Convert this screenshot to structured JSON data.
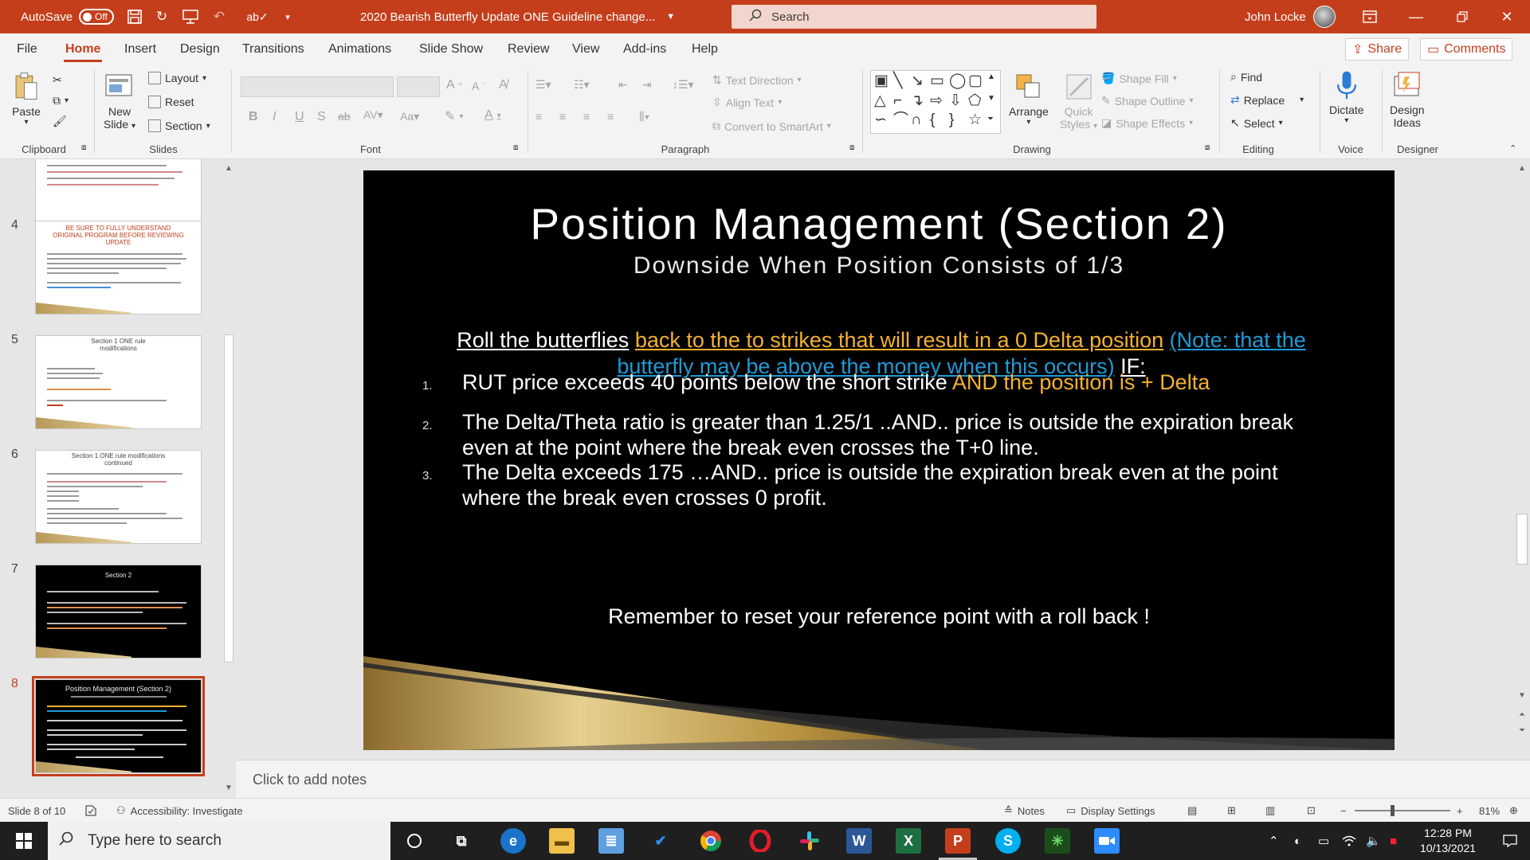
{
  "titlebar": {
    "autosave_label": "AutoSave",
    "autosave_state": "Off",
    "doc_title": "2020 Bearish Butterfly Update ONE Guideline change...",
    "search_placeholder": "Search",
    "user_name": "John Locke"
  },
  "menu": {
    "tabs": [
      "File",
      "Home",
      "Insert",
      "Design",
      "Transitions",
      "Animations",
      "Slide Show",
      "Review",
      "View",
      "Add-ins",
      "Help"
    ],
    "active_tab": "Home",
    "share_label": "Share",
    "comments_label": "Comments"
  },
  "ribbon": {
    "clipboard": {
      "paste": "Paste",
      "label": "Clipboard"
    },
    "slides": {
      "new_slide_1": "New",
      "new_slide_2": "Slide",
      "layout": "Layout",
      "reset": "Reset",
      "section": "Section",
      "label": "Slides"
    },
    "font": {
      "label": "Font"
    },
    "paragraph": {
      "text_direction": "Text Direction",
      "align_text": "Align Text",
      "convert_smartart": "Convert to SmartArt",
      "label": "Paragraph"
    },
    "drawing": {
      "arrange": "Arrange",
      "quick_styles_1": "Quick",
      "quick_styles_2": "Styles",
      "shape_fill": "Shape Fill",
      "shape_outline": "Shape Outline",
      "shape_effects": "Shape Effects",
      "label": "Drawing"
    },
    "editing": {
      "find": "Find",
      "replace": "Replace",
      "select": "Select",
      "label": "Editing"
    },
    "voice": {
      "dictate": "Dictate",
      "label": "Voice"
    },
    "designer": {
      "design_ideas_1": "Design",
      "design_ideas_2": "Ideas",
      "label": "Designer"
    }
  },
  "thumbnails": {
    "numbers": [
      "4",
      "5",
      "6",
      "7",
      "8"
    ],
    "slide4_title": "BE SURE TO FULLY UNDERSTAND ORIGINAL PROGRAM BEFORE REVIEWING UPDATE",
    "slide5_title": "Section 1 ONE rule modifications",
    "slide6_title": "Section 1 ONE rule modifications continued",
    "slide7_title": "Section 2",
    "slide8_title": "Position Management (Section 2)"
  },
  "slide": {
    "title": "Position Management (Section 2)",
    "subtitle": "Downside When Position Consists of 1/3",
    "roll_white": "Roll the butterflies",
    "roll_orange": "back to the to strikes that will result in a 0 Delta position",
    "roll_blue": "(Note: that the butterfly may be above the money when this occurs)",
    "roll_if": "IF:",
    "item1_num": "1.",
    "item1_white": "RUT price exceeds 40 points below the short strike",
    "item1_orange": "AND the position is + Delta",
    "item2_num": "2.",
    "item2": "The Delta/Theta ratio is greater than 1.25/1 ..AND.. price is outside the expiration break even at the point where the break even crosses the T+0 line.",
    "item3_num": "3.",
    "item3": "The Delta exceeds 175 …AND.. price is outside the expiration break even at the point where the break even crosses 0 profit.",
    "remember": "Remember to reset your reference point with a roll back !"
  },
  "notes": {
    "placeholder": "Click to add notes"
  },
  "status": {
    "slide_count": "Slide 8 of 10",
    "accessibility": "Accessibility: Investigate",
    "notes": "Notes",
    "display_settings": "Display Settings",
    "zoom": "81%"
  },
  "taskbar": {
    "search_placeholder": "Type here to search",
    "time": "12:28 PM",
    "date": "10/13/2021"
  },
  "colors": {
    "accent": "#c43e1c",
    "slide_orange": "#f4b132",
    "slide_blue": "#1f9ad6"
  }
}
